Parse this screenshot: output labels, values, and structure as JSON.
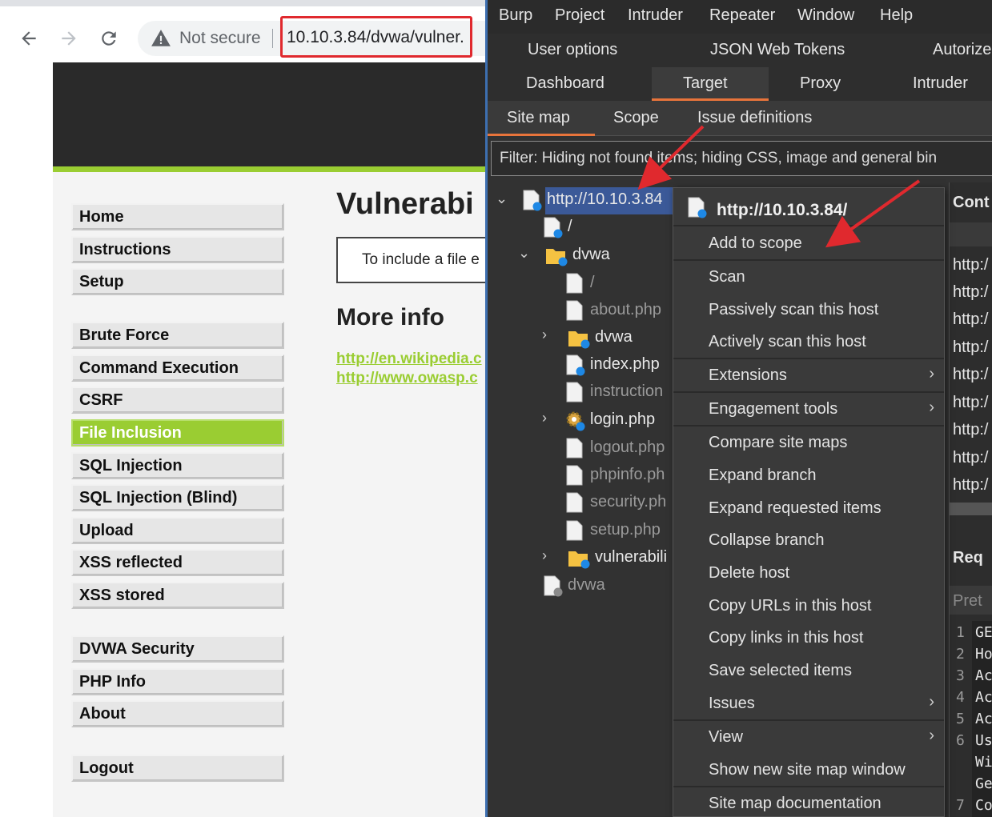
{
  "browser": {
    "not_secure": "Not secure",
    "url": "10.10.3.84/dvwa/vulner..."
  },
  "dvwa": {
    "menu": [
      "Home",
      "Instructions",
      "Setup",
      "Brute Force",
      "Command Execution",
      "CSRF",
      "File Inclusion",
      "SQL Injection",
      "SQL Injection (Blind)",
      "Upload",
      "XSS reflected",
      "XSS stored",
      "DVWA Security",
      "PHP Info",
      "About",
      "Logout"
    ],
    "active_item": "File Inclusion",
    "title": "Vulnerabi",
    "include_text": "To include a file e",
    "more_info": "More info",
    "links": [
      "http://en.wikipedia.c",
      "http://www.owasp.c"
    ],
    "accent_color": "#9acd32"
  },
  "burp": {
    "menubar": [
      "Burp",
      "Project",
      "Intruder",
      "Repeater",
      "Window",
      "Help"
    ],
    "tabs_row1": [
      "User options",
      "JSON Web Tokens",
      "Autorize"
    ],
    "tabs_row2": [
      "Dashboard",
      "Target",
      "Proxy",
      "Intruder"
    ],
    "active_tab": "Target",
    "subtabs": [
      "Site map",
      "Scope",
      "Issue definitions"
    ],
    "active_subtab": "Site map",
    "filter": "Filter: Hiding not found items;  hiding CSS, image and general bin",
    "tree": {
      "host": "http://10.10.3.84",
      "root_slash": "/",
      "dvwa_folder": "dvwa",
      "dvwa_children": [
        "/",
        "about.php",
        "dvwa",
        "index.php",
        "instruction",
        "login.php",
        "logout.php",
        "phpinfo.ph",
        "security.ph",
        "setup.php",
        "vulnerabili"
      ],
      "trailing": "dvwa"
    },
    "right_panel": {
      "contents_label": "Cont",
      "urls": [
        "http:/",
        "http:/",
        "http:/",
        "http:/",
        "http:/",
        "http:/",
        "http:/",
        "http:/",
        "http:/"
      ],
      "request_label": "Req",
      "pretty_label": "Pret",
      "lines": [
        {
          "n": "1",
          "t": "GE"
        },
        {
          "n": "2",
          "t": "Ho"
        },
        {
          "n": "3",
          "t": "Ac"
        },
        {
          "n": "4",
          "t": "Ac"
        },
        {
          "n": "5",
          "t": "Ac"
        },
        {
          "n": "6",
          "t": "Us"
        },
        {
          "n": "",
          "t": "Wi"
        },
        {
          "n": "",
          "t": "Ge"
        },
        {
          "n": "7",
          "t": "Co"
        }
      ]
    },
    "context_menu": {
      "header": "http://10.10.3.84/",
      "items": [
        "Add to scope",
        "Scan",
        "Passively scan this host",
        "Actively scan this host",
        "Extensions",
        "Engagement tools",
        "Compare site maps",
        "Expand branch",
        "Expand requested items",
        "Collapse branch",
        "Delete host",
        "Copy URLs in this host",
        "Copy links in this host",
        "Save selected items",
        "Issues",
        "View",
        "Show new site map window",
        "Site map documentation"
      ]
    },
    "accent_color": "#e8743b",
    "annotation_color": "#e0292e"
  }
}
